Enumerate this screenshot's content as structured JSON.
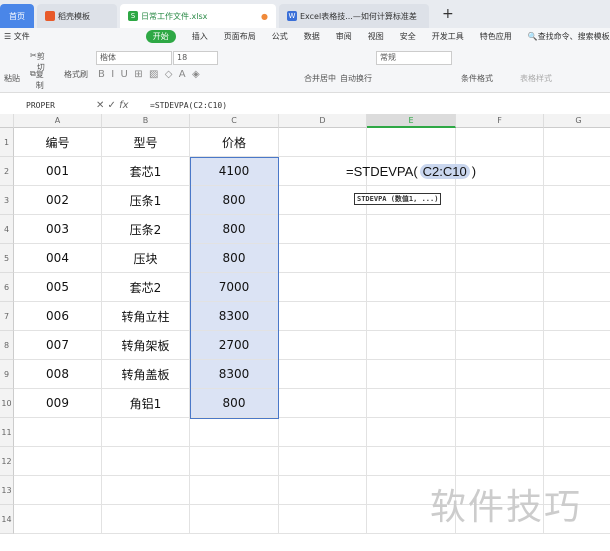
{
  "tabs": [
    {
      "label": "首页"
    },
    {
      "label": "稻壳模板"
    },
    {
      "label": "日常工作文件.xlsx"
    },
    {
      "label": "Excel表格技...—如何计算标准差"
    }
  ],
  "menu": [
    "文件",
    "开始",
    "插入",
    "页面布局",
    "公式",
    "数据",
    "审阅",
    "视图",
    "安全",
    "开发工具",
    "特色应用",
    "查找命令、搜索模板"
  ],
  "ribbon": {
    "paste": "粘贴",
    "cut": "剪切",
    "copy": "复制",
    "format_painter": "格式刷",
    "font": "楷体",
    "size": "18",
    "merge": "合并居中",
    "wrap": "自动换行",
    "number_format": "常规",
    "cond_format": "条件格式",
    "table_style": "表格样式"
  },
  "formula_bar": {
    "name_box": "PROPER",
    "formula": "=STDEVPA(C2:C10)",
    "fx": "fx"
  },
  "columns": [
    "A",
    "B",
    "C",
    "D",
    "E",
    "F",
    "G"
  ],
  "rows": [
    "1",
    "2",
    "3",
    "4",
    "5",
    "6",
    "7",
    "8",
    "9",
    "10",
    "11",
    "12",
    "13",
    "14"
  ],
  "table": {
    "headers": [
      "编号",
      "型号",
      "价格"
    ],
    "data": [
      [
        "001",
        "套芯1",
        "4100"
      ],
      [
        "002",
        "压条1",
        "800"
      ],
      [
        "003",
        "压条2",
        "800"
      ],
      [
        "004",
        "压块",
        "800"
      ],
      [
        "005",
        "套芯2",
        "7000"
      ],
      [
        "006",
        "转角立柱",
        "8300"
      ],
      [
        "007",
        "转角架板",
        "2700"
      ],
      [
        "008",
        "转角盖板",
        "8300"
      ],
      [
        "009",
        "角铝1",
        "800"
      ]
    ]
  },
  "edit": {
    "fn": "=STDEVPA",
    "open": "(",
    "ref": "C2:C10",
    "close": ")",
    "tooltip": "STDEVPA (数值1, ...)"
  },
  "watermark": "软件技巧"
}
